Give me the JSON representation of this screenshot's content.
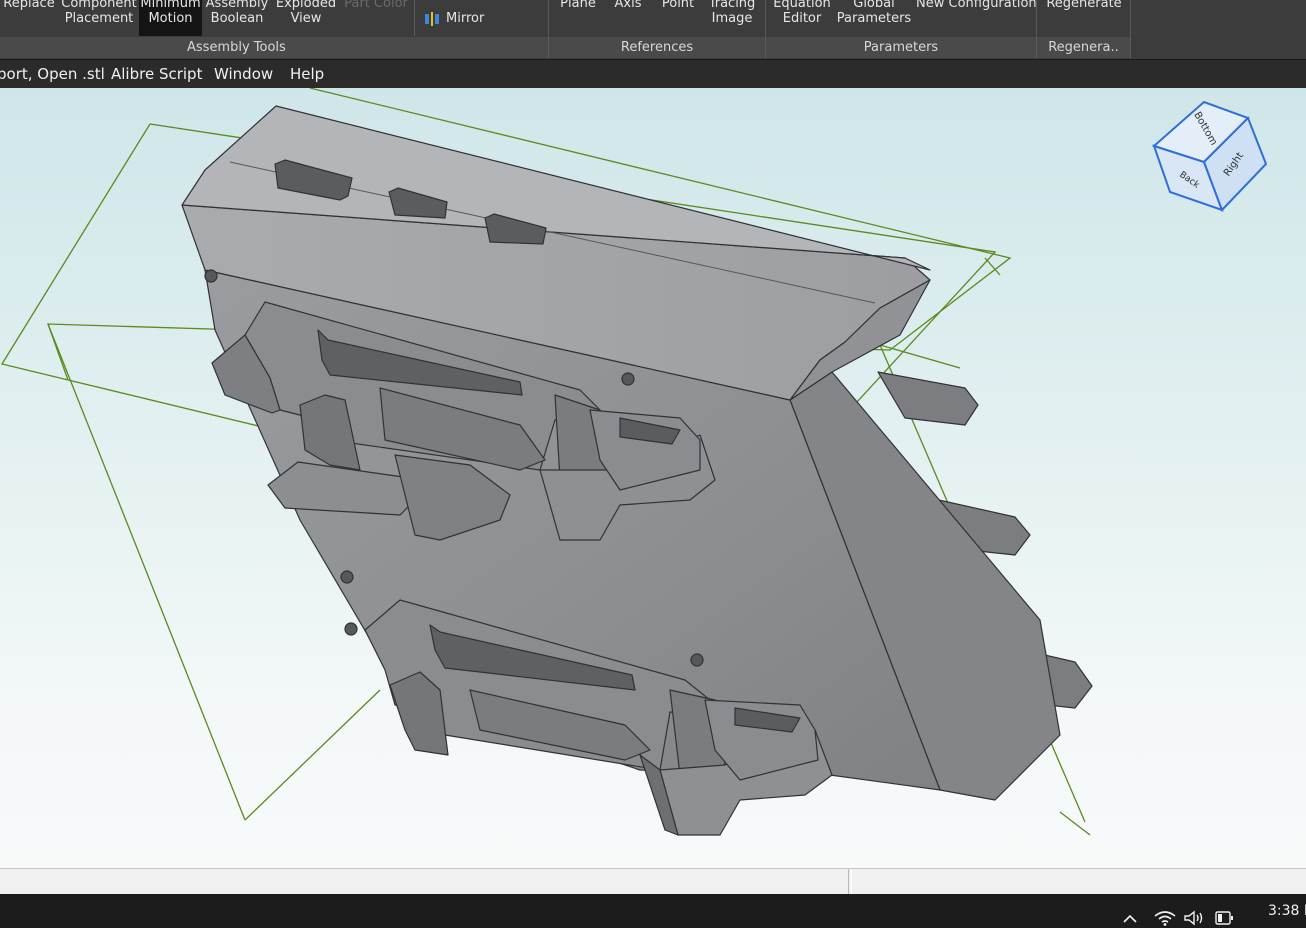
{
  "ribbon": {
    "buttons": [
      {
        "id": "replace",
        "line1": "Replace",
        "line2": ""
      },
      {
        "id": "component-placement",
        "line1": "Component",
        "line2": "Placement"
      },
      {
        "id": "minimum-motion",
        "line1": "Minimum",
        "line2": "Motion"
      },
      {
        "id": "assembly-boolean",
        "line1": "Assembly",
        "line2": "Boolean"
      },
      {
        "id": "exploded-view",
        "line1": "Exploded",
        "line2": "View"
      },
      {
        "id": "part-color",
        "line1": "Part Color",
        "line2": ""
      },
      {
        "id": "mirror",
        "line1": "Mirror",
        "line2": ""
      },
      {
        "id": "plane",
        "line1": "Plane",
        "line2": ""
      },
      {
        "id": "axis",
        "line1": "Axis",
        "line2": ""
      },
      {
        "id": "point",
        "line1": "Point",
        "line2": ""
      },
      {
        "id": "tracing-image",
        "line1": "Tracing",
        "line2": "Image"
      },
      {
        "id": "equation-editor",
        "line1": "Equation",
        "line2": "Editor"
      },
      {
        "id": "global-parameters",
        "line1": "Global",
        "line2": "Parameters"
      },
      {
        "id": "new-configuration",
        "line1": "New Configuration",
        "line2": ""
      },
      {
        "id": "regenerate",
        "line1": "Regenerate",
        "line2": ""
      }
    ],
    "groups": {
      "assembly_tools": "Assembly Tools",
      "references": "References",
      "parameters": "Parameters",
      "regenerate": "Regenera.."
    }
  },
  "menu": {
    "items": [
      "port, Open .stl",
      "Alibre Script",
      "Window",
      "Help"
    ]
  },
  "view_cube": {
    "faces": {
      "top": "Bottom",
      "left": "Back",
      "right": "Right"
    },
    "color": "#2f6fd6"
  },
  "model": {
    "body_color": "#8e9094",
    "bounding_box_color": "#5a8a1e"
  },
  "taskbar": {
    "clock_time": "3:38 P"
  }
}
